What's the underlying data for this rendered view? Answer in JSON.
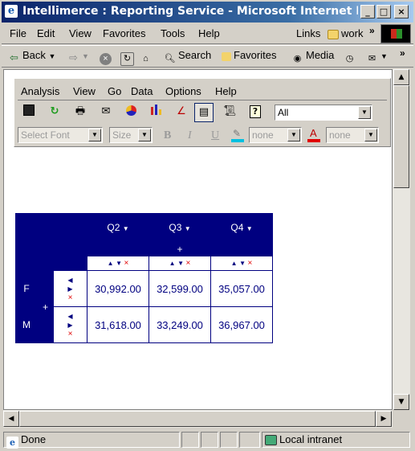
{
  "window": {
    "title": "Intellimerce : Reporting Service - Microsoft Internet Explo...",
    "controls": [
      "_",
      "□",
      "×"
    ]
  },
  "browser_menu": [
    "File",
    "Edit",
    "View",
    "Favorites",
    "Tools",
    "Help"
  ],
  "links": {
    "label": "Links",
    "folder": "work",
    "chevron": "»"
  },
  "browser_toolbar": {
    "back": "Back",
    "search": "Search",
    "favorites": "Favorites",
    "media": "Media",
    "chevron": "»"
  },
  "app": {
    "menu": [
      "Analysis",
      "View",
      "Go",
      "Data",
      "Options",
      "Help"
    ],
    "view_select": "All",
    "font_select_placeholder": "Select Font",
    "size_select_placeholder": "Size",
    "format": {
      "bold": "B",
      "italic": "I",
      "underline": "U"
    },
    "highlight_color": "none",
    "font_color": "none"
  },
  "pivot": {
    "columns": [
      "Q2",
      "Q3",
      "Q4"
    ],
    "column_expand": "+",
    "row_expand": "+",
    "rows": [
      {
        "label": "F",
        "values": [
          "30,992.00",
          "32,599.00",
          "35,057.00"
        ]
      },
      {
        "label": "M",
        "values": [
          "31,618.00",
          "33,249.00",
          "36,967.00"
        ]
      }
    ]
  },
  "status": {
    "text": "Done",
    "zone": "Local intranet"
  },
  "colors": {
    "title_start": "#0a246a",
    "header_bg": "#000080",
    "remove_x": "#e00000"
  }
}
